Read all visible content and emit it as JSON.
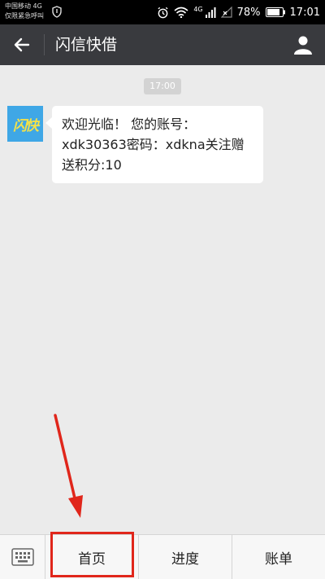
{
  "statusbar": {
    "carrier_line1": "中国移动 4G",
    "carrier_line2": "仅限紧急呼叫",
    "network": "4G",
    "battery": "78%",
    "time": "17:01"
  },
  "appbar": {
    "title": "闪信快借"
  },
  "chat": {
    "timestamp": "17:00",
    "message": "欢迎光临！ 您的账号：xdk30363密码：xdkna关注赠送积分:10",
    "avatar_text_a": "闪",
    "avatar_text_b": "快"
  },
  "bottom_menu": {
    "items": [
      {
        "label": "首页"
      },
      {
        "label": "进度"
      },
      {
        "label": "账单"
      }
    ]
  },
  "colors": {
    "appbar": "#393a3e",
    "background": "#ebebeb",
    "annotation": "#e0261b"
  }
}
